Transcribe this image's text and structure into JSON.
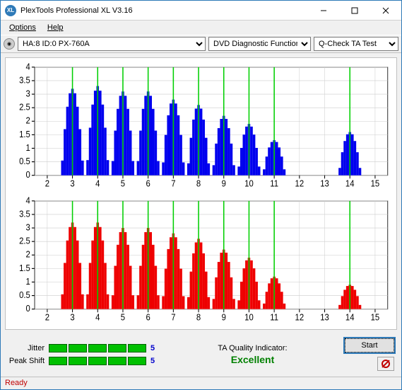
{
  "window": {
    "title": "PlexTools Professional XL V3.16"
  },
  "menu": {
    "options": "Options",
    "help": "Help"
  },
  "toolbar": {
    "drive": "HA:8 ID:0   PX-760A",
    "func": "DVD Diagnostic Functions",
    "test": "Q-Check TA Test"
  },
  "chart_data": [
    {
      "type": "bar",
      "color": "#0000ee",
      "xlim": [
        1.5,
        15.5
      ],
      "ylim": [
        0,
        4
      ],
      "xticks": [
        2,
        3,
        4,
        5,
        6,
        7,
        8,
        9,
        10,
        11,
        12,
        13,
        14,
        15
      ],
      "yticks": [
        0,
        0.5,
        1,
        1.5,
        2,
        2.5,
        3,
        3.5,
        4
      ],
      "markers": [
        3,
        4,
        5,
        6,
        7,
        8,
        9,
        10,
        11,
        14
      ],
      "peaks": [
        {
          "c": 3,
          "h": 3.2
        },
        {
          "c": 4,
          "h": 3.3
        },
        {
          "c": 5,
          "h": 3.1
        },
        {
          "c": 6,
          "h": 3.1
        },
        {
          "c": 7,
          "h": 2.8
        },
        {
          "c": 8,
          "h": 2.6
        },
        {
          "c": 9,
          "h": 2.2
        },
        {
          "c": 10,
          "h": 1.9
        },
        {
          "c": 11,
          "h": 1.3
        },
        {
          "c": 14,
          "h": 1.6
        }
      ]
    },
    {
      "type": "bar",
      "color": "#ee0000",
      "xlim": [
        1.5,
        15.5
      ],
      "ylim": [
        0,
        4
      ],
      "xticks": [
        2,
        3,
        4,
        5,
        6,
        7,
        8,
        9,
        10,
        11,
        12,
        13,
        14,
        15
      ],
      "yticks": [
        0,
        0.5,
        1,
        1.5,
        2,
        2.5,
        3,
        3.5,
        4
      ],
      "markers": [
        3,
        4,
        5,
        6,
        7,
        8,
        9,
        10,
        11,
        14
      ],
      "peaks": [
        {
          "c": 3,
          "h": 3.2
        },
        {
          "c": 4,
          "h": 3.2
        },
        {
          "c": 5,
          "h": 3.0
        },
        {
          "c": 6,
          "h": 3.0
        },
        {
          "c": 7,
          "h": 2.8
        },
        {
          "c": 8,
          "h": 2.6
        },
        {
          "c": 9,
          "h": 2.2
        },
        {
          "c": 10,
          "h": 1.9
        },
        {
          "c": 11,
          "h": 1.2
        },
        {
          "c": 14,
          "h": 0.9
        }
      ]
    }
  ],
  "metrics": {
    "jitter": {
      "label": "Jitter",
      "segments": 5,
      "value": "5"
    },
    "peakshift": {
      "label": "Peak Shift",
      "segments": 5,
      "value": "5"
    }
  },
  "quality": {
    "label": "TA Quality Indicator:",
    "value": "Excellent"
  },
  "buttons": {
    "start": "Start"
  },
  "status": "Ready"
}
